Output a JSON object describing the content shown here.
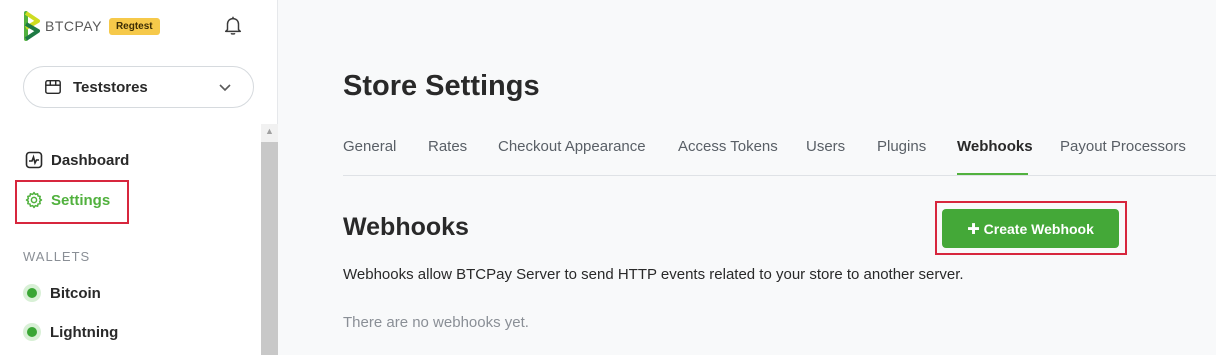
{
  "sidebar": {
    "brand_text": "BTCPAY",
    "badge": "Regtest",
    "store_name": "Teststores",
    "nav": {
      "dashboard": "Dashboard",
      "settings": "Settings"
    },
    "wallets_title": "WALLETS",
    "wallets": [
      "Bitcoin",
      "Lightning"
    ]
  },
  "main": {
    "page_title": "Store Settings",
    "tabs": [
      "General",
      "Rates",
      "Checkout Appearance",
      "Access Tokens",
      "Users",
      "Plugins",
      "Webhooks",
      "Payout Processors"
    ],
    "active_tab": "Webhooks",
    "section_heading": "Webhooks",
    "create_button": "Create Webhook",
    "description": "Webhooks allow BTCPay Server to send HTTP events related to your store to another server.",
    "empty_state": "There are no webhooks yet."
  },
  "colors": {
    "accent": "#51b13e",
    "button_green": "#44a838",
    "badge": "#f6c94a",
    "highlight": "#d7263d"
  },
  "icons": [
    "btcpay-logo",
    "bell-icon",
    "store-icon",
    "chevron-down-icon",
    "dashboard-icon",
    "gear-icon",
    "wallet-status-icon"
  ]
}
